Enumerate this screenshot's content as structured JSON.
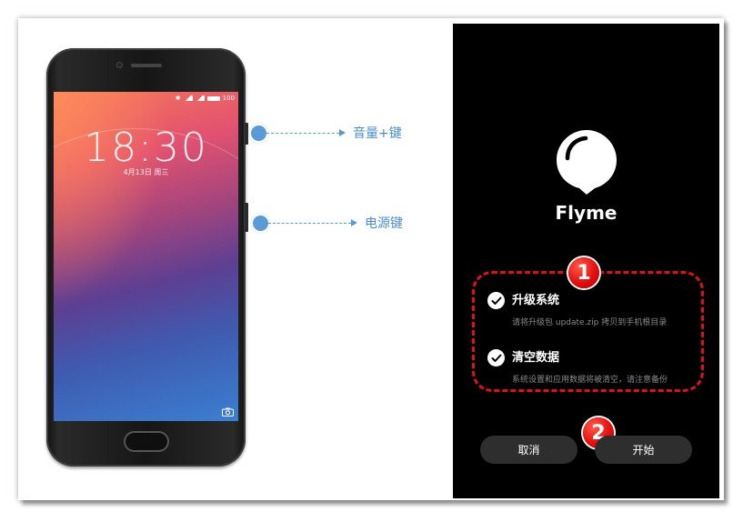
{
  "phone": {
    "status_battery": "100",
    "clock": "18:30",
    "date": "4月13日 周三"
  },
  "callouts": {
    "volume_label": "音量+键",
    "power_label": "电源键"
  },
  "dialog": {
    "brand": "Flyme",
    "options": [
      {
        "title": "升级系统",
        "desc": "请将升级包 update.zip 拷贝到手机根目录",
        "checked": true
      },
      {
        "title": "清空数据",
        "desc": "系统设置和应用数据将被清空，请注意备份",
        "checked": true
      }
    ],
    "cancel_label": "取消",
    "start_label": "开始"
  },
  "badges": {
    "step1": "1",
    "step2": "2"
  },
  "colors": {
    "callout_blue": "#5a9ad6",
    "highlight_red": "#e0101a",
    "panel_bg": "#000000",
    "button_bg": "#2e2e2e"
  }
}
